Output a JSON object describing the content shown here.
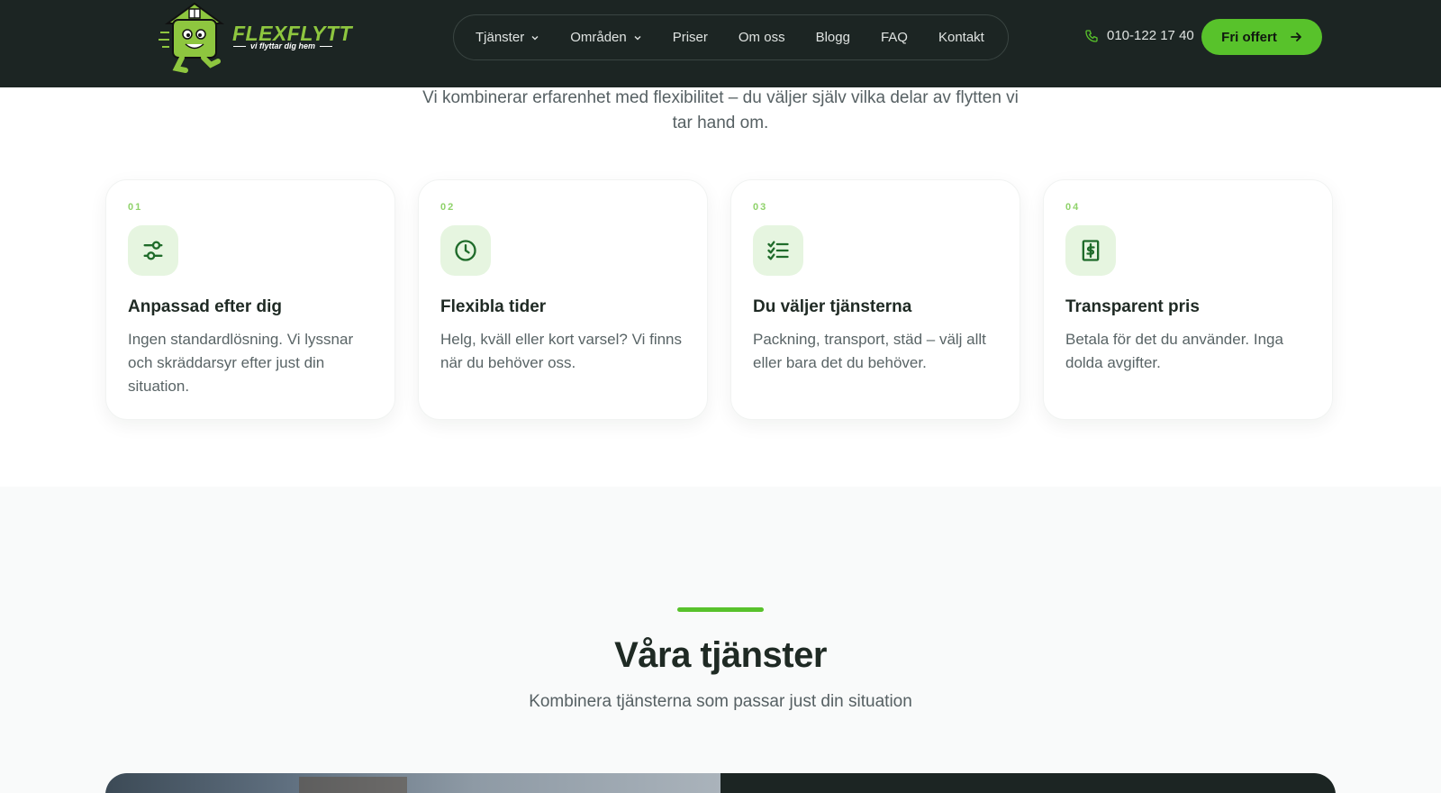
{
  "header": {
    "logo": {
      "title": "FLEXFLYTT",
      "tagline": "vi flyttar dig hem"
    },
    "nav": [
      {
        "label": "Tjänster",
        "dropdown": true
      },
      {
        "label": "Områden",
        "dropdown": true
      },
      {
        "label": "Priser",
        "dropdown": false
      },
      {
        "label": "Om oss",
        "dropdown": false
      },
      {
        "label": "Blogg",
        "dropdown": false
      },
      {
        "label": "FAQ",
        "dropdown": false
      },
      {
        "label": "Kontakt",
        "dropdown": false
      }
    ],
    "phone": "010-122 17 40",
    "cta_label": "Fri offert"
  },
  "intro": {
    "text": "Vi kombinerar erfarenhet med flexibilitet – du väljer själv vilka delar av flytten vi tar hand om."
  },
  "features": [
    {
      "num": "01",
      "icon": "sliders-icon",
      "title": "Anpassad efter dig",
      "text": "Ingen standardlösning. Vi lyssnar och skräddarsyr efter just din situation."
    },
    {
      "num": "02",
      "icon": "clock-icon",
      "title": "Flexibla tider",
      "text": "Helg, kväll eller kort varsel? Vi finns när du behöver oss."
    },
    {
      "num": "03",
      "icon": "checklist-icon",
      "title": "Du väljer tjänsterna",
      "text": "Packning, transport, städ – välj allt eller bara det du behöver."
    },
    {
      "num": "04",
      "icon": "receipt-dollar-icon",
      "title": "Transparent pris",
      "text": "Betala för det du använder. Inga dolda avgifter."
    }
  ],
  "services": {
    "title": "Våra tjänster",
    "subtitle": "Kombinera tjänsterna som passar just din situation"
  },
  "colors": {
    "header_bg": "#1c2523",
    "accent_green": "#58c22b",
    "logo_green": "#8ec63f",
    "icon_bg": "#e6f5e0"
  }
}
